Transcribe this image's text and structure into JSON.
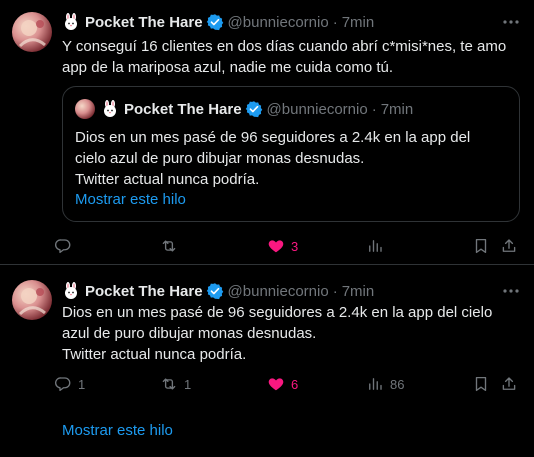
{
  "colors": {
    "background": "#000000",
    "text": "#e7e9ea",
    "muted": "#71767b",
    "link": "#1d9bf0",
    "verified": "#1d9bf0",
    "like_active": "#f91880",
    "divider": "#2f3336"
  },
  "tweets": [
    {
      "author": {
        "name": "Pocket The Hare",
        "handle": "@bunniecornio",
        "time": "7min",
        "separator": "·"
      },
      "text_lines": [
        "Y conseguí 16 clientes en dos días cuando abrí c*misi*nes, te amo",
        "app de la mariposa azul, nadie me cuida como tú."
      ],
      "quote": {
        "author": {
          "name": "Pocket The Hare",
          "handle": "@bunniecornio",
          "time": "7min",
          "separator": "·"
        },
        "text_lines": [
          "Dios en un mes pasé de 96 seguidores a 2.4k en la app del",
          "cielo azul de puro dibujar monas desnudas.",
          "Twitter actual nunca podría."
        ],
        "show_thread": "Mostrar este hilo"
      },
      "actions": {
        "reply": "",
        "repost": "",
        "like": "3",
        "like_active": true,
        "views": ""
      }
    },
    {
      "author": {
        "name": "Pocket The Hare",
        "handle": "@bunniecornio",
        "time": "7min",
        "separator": "·"
      },
      "text_lines": [
        "Dios en un mes pasé de 96 seguidores a 2.4k en la app del cielo",
        "azul de puro dibujar monas desnudas.",
        "Twitter actual nunca podría."
      ],
      "actions": {
        "reply": "1",
        "repost": "1",
        "like": "6",
        "like_active": true,
        "views": "86"
      },
      "show_thread": "Mostrar este hilo"
    }
  ],
  "icons": {
    "display_name_emoji": "bunny-face-emoji",
    "verified": "verified-badge-icon",
    "more": "more-dots-icon",
    "reply": "reply-bubble-icon",
    "repost": "repost-arrows-icon",
    "like": "heart-filled-icon",
    "views": "views-bar-chart-icon",
    "bookmark": "bookmark-icon",
    "share": "share-upload-icon"
  }
}
